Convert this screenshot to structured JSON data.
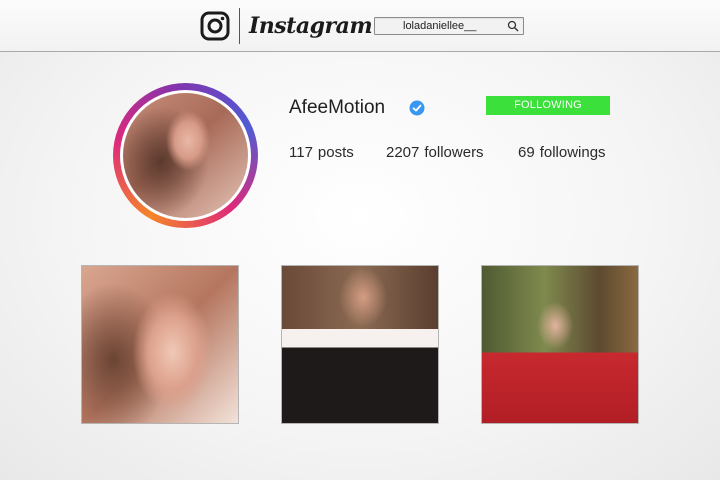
{
  "header": {
    "brand": "Instagram",
    "logo_icon": "instagram-camera-icon",
    "search": {
      "value": "loladaniellee__",
      "icon": "search-icon"
    }
  },
  "profile": {
    "username": "AfeeMotion",
    "verified_icon": "verified-badge-icon",
    "follow_button": "FOLLOWING",
    "follow_button_color": "#3be03b",
    "stats": {
      "posts_count": "117",
      "posts_label": "posts",
      "followers_count": "2207",
      "followers_label": "followers",
      "following_count": "69",
      "following_label": "followings"
    }
  },
  "colors": {
    "verified": "#3897f0",
    "ring": [
      "#f58529",
      "#dd2a7b",
      "#8134af",
      "#515bd4"
    ]
  }
}
